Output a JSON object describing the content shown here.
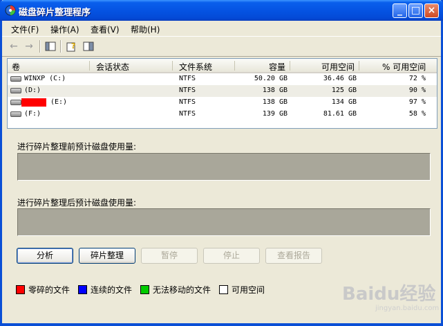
{
  "window": {
    "title": "磁盘碎片整理程序"
  },
  "menu": [
    "文件(F)",
    "操作(A)",
    "查看(V)",
    "帮助(H)"
  ],
  "columns": [
    "卷",
    "会话状态",
    "文件系统",
    "容量",
    "可用空间",
    "% 可用空间"
  ],
  "volumes": [
    {
      "name": "WINXP (C:)",
      "status": "",
      "fs": "NTFS",
      "capacity": "50.20 GB",
      "free": "36.46 GB",
      "pct": "72 %"
    },
    {
      "name": "(D:)",
      "status": "",
      "fs": "NTFS",
      "capacity": "138 GB",
      "free": "125 GB",
      "pct": "90 %"
    },
    {
      "name": "(E:)",
      "status": "",
      "fs": "NTFS",
      "capacity": "138 GB",
      "free": "134 GB",
      "pct": "97 %"
    },
    {
      "name": "(F:)",
      "status": "",
      "fs": "NTFS",
      "capacity": "139 GB",
      "free": "81.61 GB",
      "pct": "58 %"
    }
  ],
  "panels": {
    "before_label": "进行碎片整理前预计磁盘使用量:",
    "after_label": "进行碎片整理后预计磁盘使用量:"
  },
  "buttons": {
    "analyze": "分析",
    "defrag": "碎片整理",
    "pause": "暂停",
    "stop": "停止",
    "report": "查看报告"
  },
  "legend": [
    {
      "label": "零碎的文件",
      "color": "#ff0000"
    },
    {
      "label": "连续的文件",
      "color": "#0000ff"
    },
    {
      "label": "无法移动的文件",
      "color": "#00cc00"
    },
    {
      "label": "可用空间",
      "color": "#ffffff"
    }
  ],
  "watermark": {
    "text": "Baidu经验",
    "sub": "jingyan.baidu.com"
  }
}
